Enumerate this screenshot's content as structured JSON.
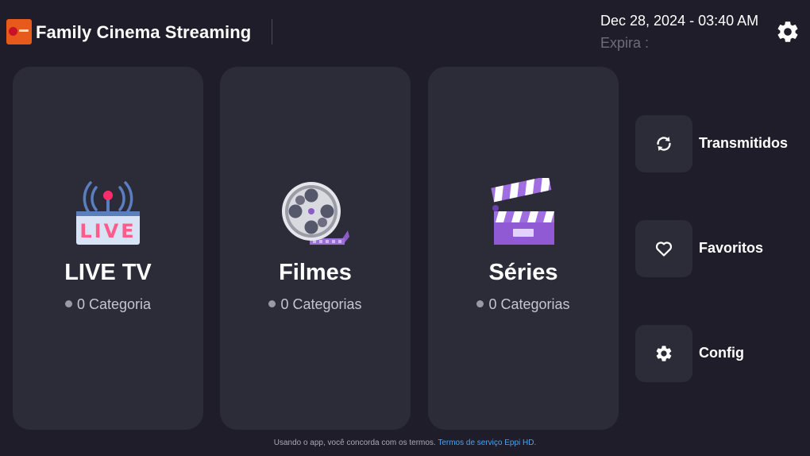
{
  "header": {
    "title": "Family Cinema Streaming",
    "datetime": "Dec 28, 2024 - 03:40 AM",
    "expira": "Expira :"
  },
  "cards": [
    {
      "title": "LIVE TV",
      "subtitle": "0 Categoria",
      "icon_text": "LIVE",
      "icon": "live-broadcast-icon"
    },
    {
      "title": "Filmes",
      "subtitle": "0 Categorias",
      "icon": "film-reel-icon"
    },
    {
      "title": "Séries",
      "subtitle": "0 Categorias",
      "icon": "clapperboard-icon"
    }
  ],
  "side": [
    {
      "label": "Transmitidos",
      "icon": "refresh-icon"
    },
    {
      "label": "Favoritos",
      "icon": "heart-icon"
    },
    {
      "label": "Config",
      "icon": "gear-icon"
    }
  ],
  "footer": {
    "text": "Usando o app, você concorda com os termos.",
    "link": "Termos de serviço Eppi HD."
  },
  "colors": {
    "background": "#1e1d29",
    "card": "#2c2b38",
    "link": "#4aa3f0",
    "logo": "#e85a1c",
    "accent_purple": "#9b59d6"
  }
}
